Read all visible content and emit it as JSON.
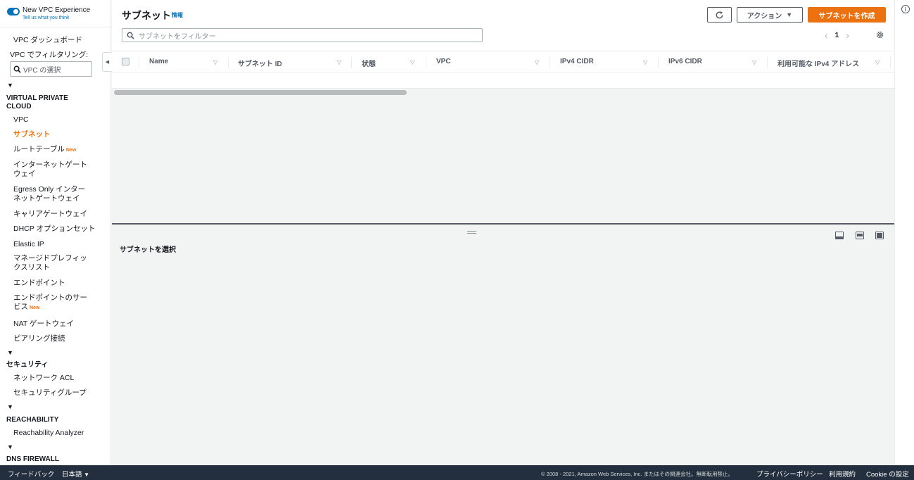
{
  "sidebar": {
    "new_vpc_title": "New VPC Experience",
    "new_vpc_sub": "Tell us what you think",
    "dashboard": "VPC ダッシュボード",
    "filter_label": "VPC でフィルタリング:",
    "filter_placeholder": "VPC の選択",
    "sections": [
      {
        "title": "VIRTUAL PRIVATE CLOUD"
      },
      {
        "title": "セキュリティ"
      },
      {
        "title": "REACHABILITY"
      },
      {
        "title": "DNS FIREWALL"
      }
    ],
    "vpc_items": [
      {
        "label": "VPC"
      },
      {
        "label": "サブネット"
      },
      {
        "label": "ルートテーブル",
        "badge": "New"
      },
      {
        "label": "インターネットゲートウェイ"
      },
      {
        "label": "Egress Only インターネットゲートウェイ"
      },
      {
        "label": "キャリアゲートウェイ"
      },
      {
        "label": "DHCP オプションセット"
      },
      {
        "label": "Elastic IP"
      },
      {
        "label": "マネージドプレフィックスリスト"
      },
      {
        "label": "エンドポイント"
      },
      {
        "label": "エンドポイントのサービス",
        "badge": "New"
      },
      {
        "label": "NAT ゲートウェイ"
      },
      {
        "label": "ピアリング接続"
      }
    ],
    "security_items": [
      {
        "label": "ネットワーク ACL"
      },
      {
        "label": "セキュリティグループ"
      }
    ],
    "reachability_items": [
      {
        "label": "Reachability Analyzer"
      }
    ]
  },
  "main": {
    "title": "サブネット",
    "info": "情報",
    "actions_label": "アクション",
    "create_label": "サブネットを作成",
    "filter_placeholder": "サブネットをフィルター",
    "page_number": "1",
    "columns": [
      "Name",
      "サブネット ID",
      "状態",
      "VPC",
      "IPv4 CIDR",
      "IPv6 CIDR",
      "利用可能な IPv4 アドレス"
    ]
  },
  "split": {
    "title": "サブネットを選択"
  },
  "footer": {
    "feedback": "フィードバック",
    "language": "日本語",
    "copyright": "© 2008 - 2021, Amazon Web Services, Inc. またはその関連会社。無断転用禁止。",
    "privacy": "プライバシーポリシー",
    "terms": "利用規約",
    "cookie": "Cookie の設定"
  },
  "colors": {
    "accent": "#ec7211",
    "link": "#0073bb",
    "footer_bg": "#232f3e"
  }
}
